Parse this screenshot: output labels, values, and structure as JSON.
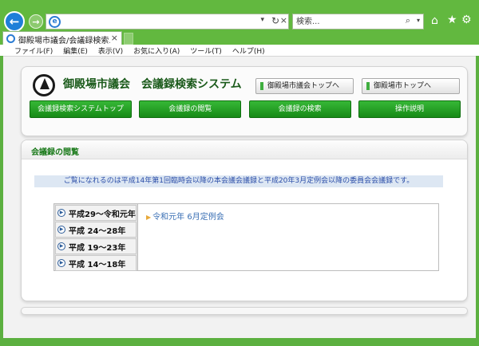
{
  "browser": {
    "address": {
      "value": "",
      "dropdown_glyph": "▾",
      "refresh_glyph": "↻",
      "close_glyph": "×"
    },
    "search": {
      "placeholder": "検索...",
      "icon_glyph": "⌕",
      "dropdown_glyph": "▾"
    },
    "nav": {
      "back_glyph": "←",
      "forward_glyph": "→",
      "home_glyph": "⌂",
      "favorites_glyph": "★",
      "tools_glyph": "⚙"
    },
    "tab": {
      "label": "御殿場市議会/会議録検索...",
      "close_glyph": "×"
    },
    "menu": [
      "ファイル(F)",
      "編集(E)",
      "表示(V)",
      "お気に入り(A)",
      "ツール(T)",
      "ヘルプ(H)"
    ]
  },
  "header": {
    "site_title": "御殿場市議会　会議録検索システム",
    "links": [
      "御殿場市議会トップへ",
      "御殿場市トップへ"
    ],
    "global_nav": [
      "会議録検索システムトップ",
      "会議録の閲覧",
      "会議録の検索",
      "操作説明"
    ]
  },
  "section": {
    "title": "会議録の閲覧",
    "notice": "ご覧になれるのは平成14年第1回臨時会以降の本会議会議録と平成20年3月定例会以降の委員会会議録です。",
    "years": [
      "平成29～令和元年",
      "平成 24～28年",
      "平成 19～23年",
      "平成 14～18年"
    ],
    "sessions": [
      "令和元年 6月定例会"
    ]
  },
  "colors": {
    "frame_green": "#62b83f",
    "nav_green": "#1f9a1f",
    "title_green": "#1a5a1a",
    "link_blue": "#3a6fb4",
    "notice_bg": "#dde7f3",
    "notice_text": "#2a4da8",
    "bullet_orange": "#e8a93a"
  },
  "icons": [
    "back-icon",
    "forward-icon",
    "ie-icon",
    "refresh-icon",
    "search-icon",
    "home-icon",
    "star-icon",
    "gear-icon",
    "close-icon",
    "circle-arrow-icon",
    "triangle-bullet-icon"
  ]
}
